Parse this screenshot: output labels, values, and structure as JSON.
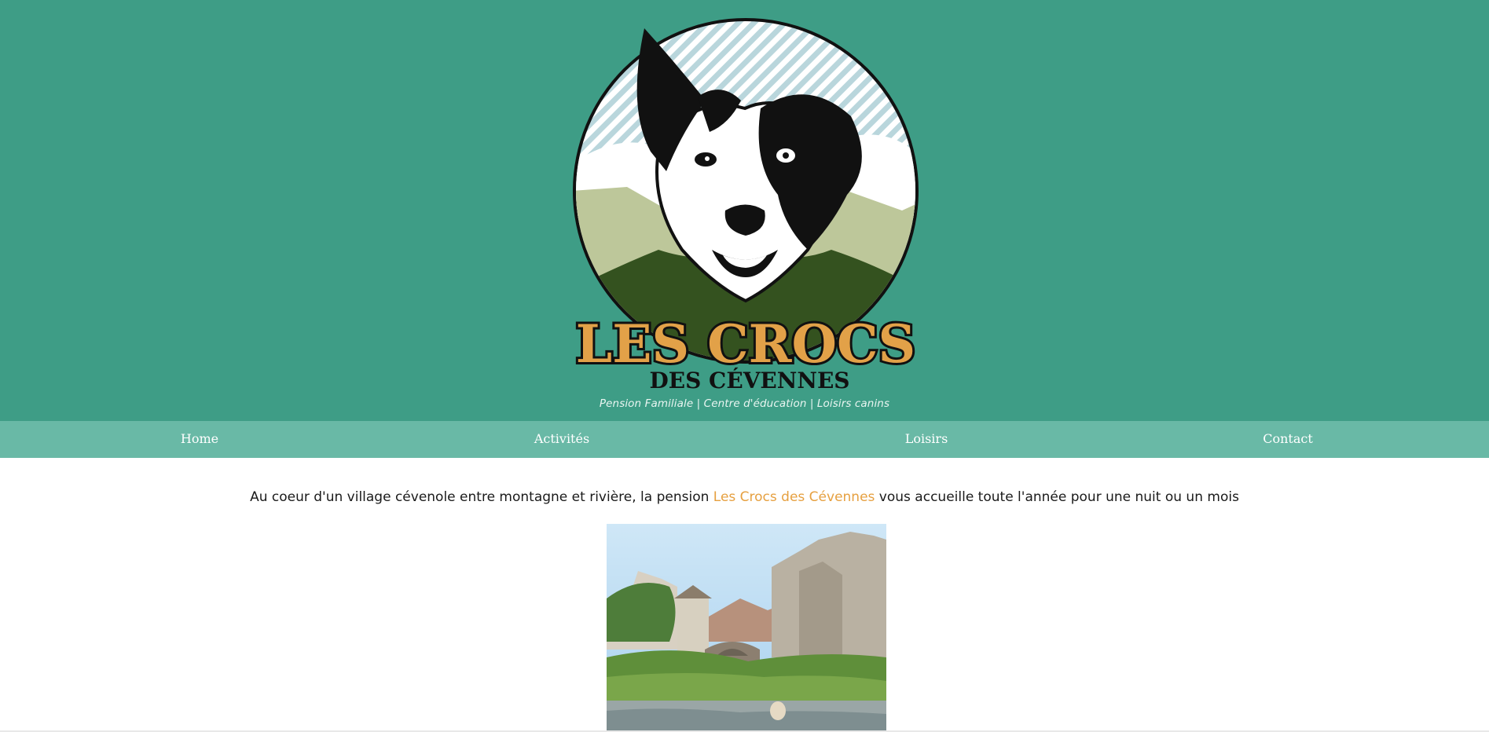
{
  "header": {
    "logo": {
      "title": "LES CROCS",
      "subtitle": "DES CÉVENNES",
      "icon": "border-collie-dog-logo"
    },
    "tagline": "Pension Familiale | Centre d'éducation | Loisirs canins"
  },
  "nav": {
    "items": [
      {
        "label": "Home"
      },
      {
        "label": "Activités"
      },
      {
        "label": "Loisirs"
      },
      {
        "label": "Contact"
      }
    ]
  },
  "main": {
    "intro_before": "Au coeur d'un village cévenole entre montagne et rivière, la pension ",
    "intro_highlight": "Les Crocs des Cévennes",
    "intro_after": " vous accueille toute l'année pour une nuit ou un mois",
    "photo": "village-river-photo"
  },
  "colors": {
    "header_bg": "#3e9d86",
    "nav_bg": "#69b9a6",
    "accent": "#e6a040"
  }
}
